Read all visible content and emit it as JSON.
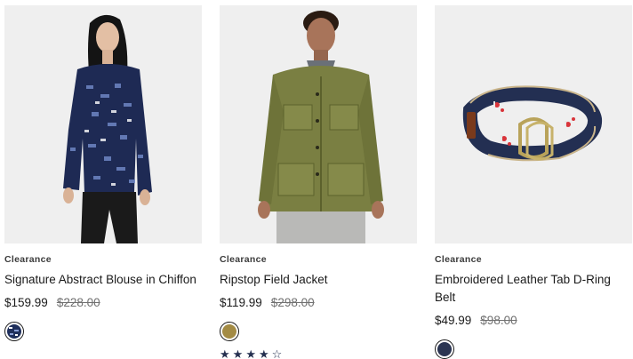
{
  "products": [
    {
      "badge": "Clearance",
      "name": "Signature Abstract Blouse in Chiffon",
      "sale_price": "$159.99",
      "original_price": "$228.00",
      "swatch_color": "#1f2f5c",
      "image_alt": "Signature Abstract Blouse in Chiffon"
    },
    {
      "badge": "Clearance",
      "name": "Ripstop Field Jacket",
      "sale_price": "$119.99",
      "original_price": "$298.00",
      "swatch_color": "#a38b44",
      "rating": 4,
      "rating_max": 5,
      "image_alt": "Ripstop Field Jacket"
    },
    {
      "badge": "Clearance",
      "name": "Embroidered Leather Tab D-Ring Belt",
      "sale_price": "$49.99",
      "original_price": "$98.00",
      "swatch_color": "#2b3552",
      "image_alt": "Embroidered Leather Tab D-Ring Belt"
    }
  ]
}
